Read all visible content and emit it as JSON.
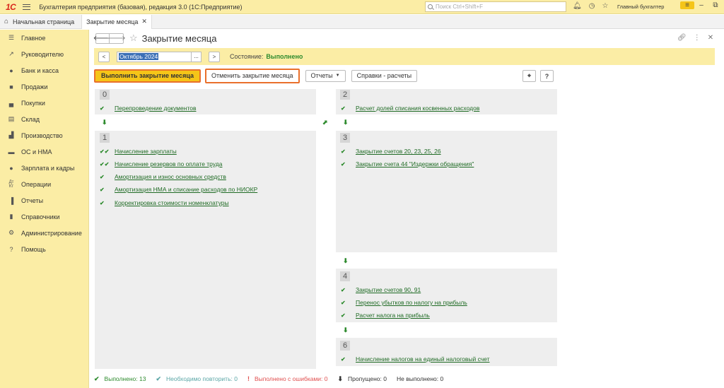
{
  "titlebar": {
    "logo": "1С",
    "app_title": "Бухгалтерия предприятия (базовая), редакция 3.0  (1С:Предприятие)",
    "search_placeholder": "Поиск Ctrl+Shift+F",
    "user": "Главный бухгалтер",
    "icons": [
      "bell-icon",
      "history-icon",
      "star-icon",
      "menu-icon"
    ]
  },
  "tabs": {
    "home": "Начальная страница",
    "active": "Закрытие месяца"
  },
  "sidebar": {
    "items": [
      {
        "label": "Главное",
        "icon": "menu-lines-icon"
      },
      {
        "label": "Руководителю",
        "icon": "trend-icon"
      },
      {
        "label": "Банк и касса",
        "icon": "coin-icon"
      },
      {
        "label": "Продажи",
        "icon": "bag-icon"
      },
      {
        "label": "Покупки",
        "icon": "cart-icon"
      },
      {
        "label": "Склад",
        "icon": "warehouse-icon"
      },
      {
        "label": "Производство",
        "icon": "factory-icon"
      },
      {
        "label": "ОС и НМА",
        "icon": "truck-icon"
      },
      {
        "label": "Зарплата и кадры",
        "icon": "person-icon"
      },
      {
        "label": "Операции",
        "icon": "operations-icon"
      },
      {
        "label": "Отчеты",
        "icon": "chart-icon"
      },
      {
        "label": "Справочники",
        "icon": "book-icon"
      },
      {
        "label": "Администрирование",
        "icon": "gear-icon"
      },
      {
        "label": "Помощь",
        "icon": "question-icon"
      }
    ]
  },
  "form": {
    "title": "Закрытие месяца",
    "period_value": "Октябрь 2024",
    "prev_label": "<",
    "next_label": ">",
    "dots_label": "...",
    "state_label": "Состояние:",
    "state_value": "Выполнено",
    "buttons": {
      "run": "Выполнить закрытие месяца",
      "cancel": "Отменить закрытие месяца",
      "reports": "Отчеты",
      "certificates": "Справки - расчеты",
      "help": "?"
    }
  },
  "steps": [
    {
      "num": "0",
      "tasks": [
        {
          "label": "Перепроведение документов",
          "check": "single"
        }
      ]
    },
    {
      "num": "1",
      "tasks": [
        {
          "label": "Начисление зарплаты",
          "check": "double"
        },
        {
          "label": "Начисление резервов по оплате труда",
          "check": "double"
        },
        {
          "label": "Амортизация и износ основных средств",
          "check": "single"
        },
        {
          "label": "Амортизация НМА и списание расходов по НИОКР",
          "check": "single"
        },
        {
          "label": "Корректировка стоимости номенклатуры",
          "check": "single"
        }
      ]
    },
    {
      "num": "2",
      "tasks": [
        {
          "label": "Расчет долей списания косвенных расходов",
          "check": "single"
        }
      ]
    },
    {
      "num": "3",
      "tasks": [
        {
          "label": "Закрытие счетов 20, 23, 25, 26",
          "check": "single"
        },
        {
          "label": "Закрытие счета 44 \"Издержки обращения\"",
          "check": "single"
        }
      ]
    },
    {
      "num": "4",
      "tasks": [
        {
          "label": "Закрытие счетов 90, 91",
          "check": "single"
        },
        {
          "label": "Перенос убытков по налогу на прибыль",
          "check": "single"
        },
        {
          "label": "Расчет налога на прибыль",
          "check": "single"
        }
      ]
    },
    {
      "num": "6",
      "tasks": [
        {
          "label": "Начисление налогов на единый налоговый счет",
          "check": "single"
        }
      ]
    }
  ],
  "footer": {
    "done": "Выполнено: 13",
    "repeat": "Необходимо повторить: 0",
    "errors": "Выполнено с ошибками: 0",
    "skipped": "Пропущено: 0",
    "not_done": "Не выполнено: 0",
    "colors": {
      "done": "#2e8b2e",
      "repeat": "#5aa6a6",
      "errors": "#e05050",
      "skipped": "#333333",
      "not_done": "#333333"
    }
  }
}
